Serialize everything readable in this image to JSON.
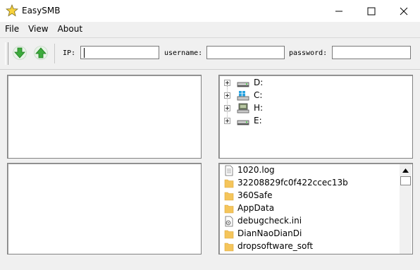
{
  "window": {
    "title": "EasySMB",
    "icon": "star-icon",
    "controls": [
      "minimize-icon",
      "maximize-icon",
      "close-icon"
    ]
  },
  "menu": {
    "items": [
      "File",
      "View",
      "About"
    ]
  },
  "toolbar": {
    "download_icon": "arrow-down-icon",
    "upload_icon": "arrow-up-icon",
    "ip_label": "IP:",
    "ip_value": "",
    "username_label": "username:",
    "username_value": "",
    "password_label": "password:",
    "password_value": ""
  },
  "drive_tree": {
    "items": [
      {
        "label": "D:",
        "icon": "drive-icon"
      },
      {
        "label": "C:",
        "icon": "windows-drive-icon"
      },
      {
        "label": "H:",
        "icon": "network-drive-icon"
      },
      {
        "label": "E:",
        "icon": "drive-icon"
      }
    ]
  },
  "file_list": {
    "items": [
      {
        "label": "1020.log",
        "icon": "text-file-icon"
      },
      {
        "label": "32208829fc0f422ccec13b",
        "icon": "folder-icon"
      },
      {
        "label": "360Safe",
        "icon": "folder-icon"
      },
      {
        "label": "AppData",
        "icon": "folder-icon"
      },
      {
        "label": "debugcheck.ini",
        "icon": "settings-file-icon"
      },
      {
        "label": "DianNaoDianDi",
        "icon": "folder-icon"
      },
      {
        "label": "dropsoftware_soft",
        "icon": "folder-icon"
      }
    ]
  },
  "colors": {
    "folder": "#f5c55b",
    "arrow_green": "#3cab3c",
    "window_bg": "#f0f0f0"
  }
}
